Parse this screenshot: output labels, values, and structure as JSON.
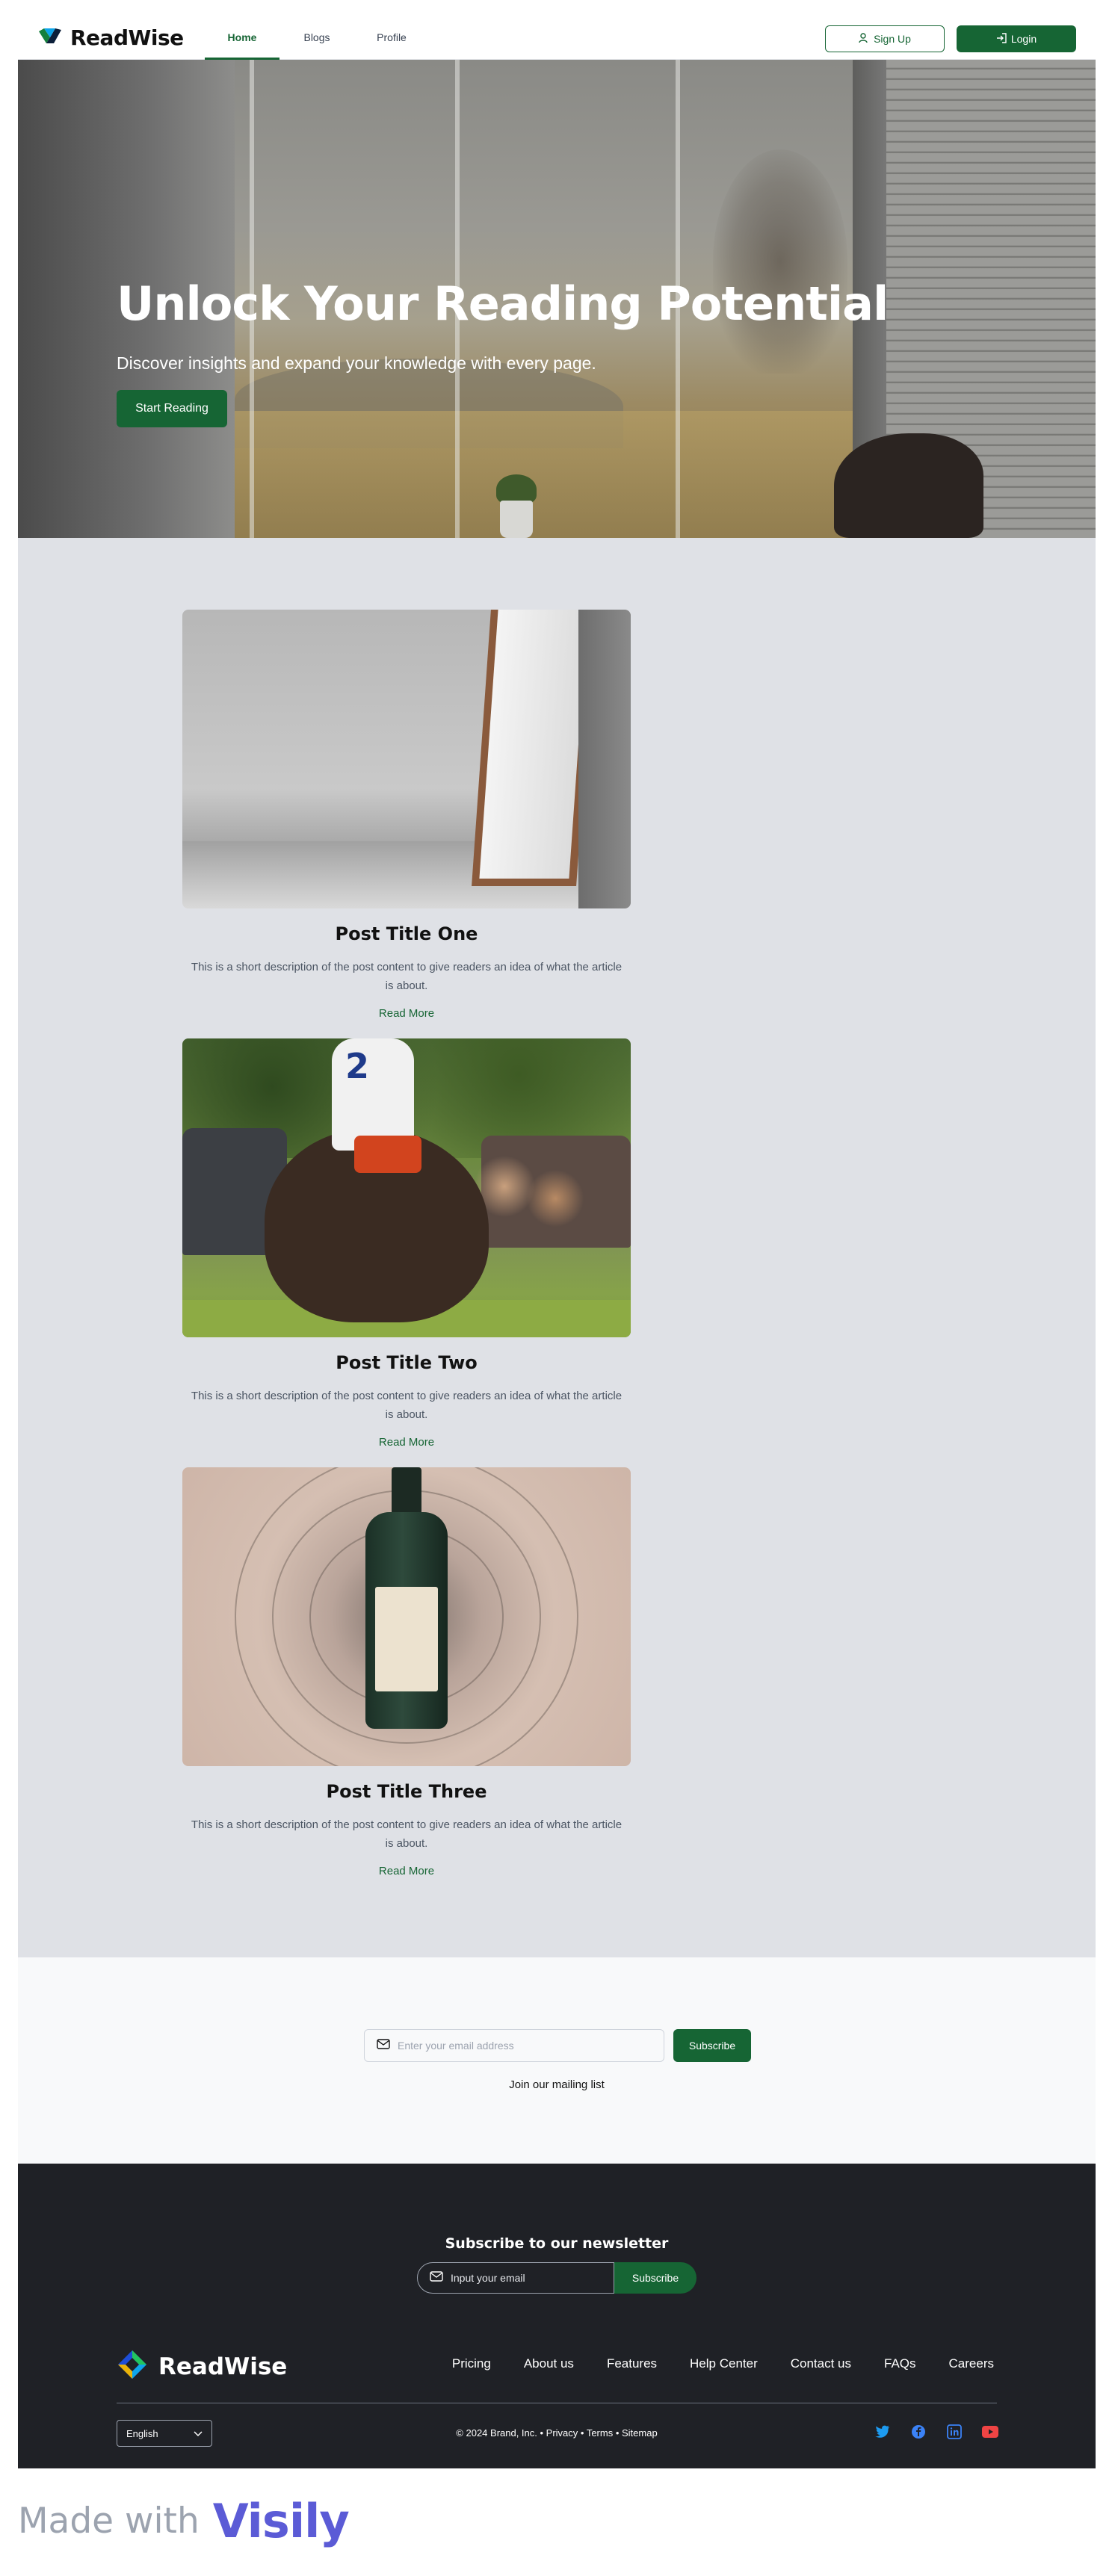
{
  "nav": {
    "brand": "ReadWise",
    "links": [
      "Home",
      "Blogs",
      "Profile"
    ],
    "signup_label": "Sign Up",
    "login_label": "Login",
    "accent": "#166534"
  },
  "hero": {
    "title": "Unlock Your Reading Potential",
    "subtitle": "Discover insights and expand your knowledge with every page.",
    "cta_label": "Start Reading"
  },
  "posts": [
    {
      "title": "Post Title One",
      "description": "This is a short description of the post content to give readers an idea of what the article is about.",
      "link_label": "Read More"
    },
    {
      "title": "Post Title Two",
      "description": "This is a short description of the post content to give readers an idea of what the article is about.",
      "link_label": "Read More"
    },
    {
      "title": "Post Title Three",
      "description": "This is a short description of the post content to give readers an idea of what the article is about.",
      "link_label": "Read More"
    }
  ],
  "mailing": {
    "placeholder": "Enter your email address",
    "button_label": "Subscribe",
    "label": "Join our mailing list"
  },
  "footer": {
    "newsletter_title": "Subscribe to our newsletter",
    "newsletter_placeholder": "Input your email",
    "newsletter_button": "Subscribe",
    "brand": "ReadWise",
    "links": [
      "Pricing",
      "About us",
      "Features",
      "Help Center",
      "Contact us",
      "FAQs",
      "Careers"
    ],
    "language": "English",
    "copyright": "© 2024 Brand, Inc. • Privacy • Terms • Sitemap",
    "socials": [
      "twitter-icon",
      "facebook-icon",
      "linkedin-icon",
      "youtube-icon"
    ]
  },
  "made_with": {
    "text": "Made with",
    "logo": "Visily"
  }
}
